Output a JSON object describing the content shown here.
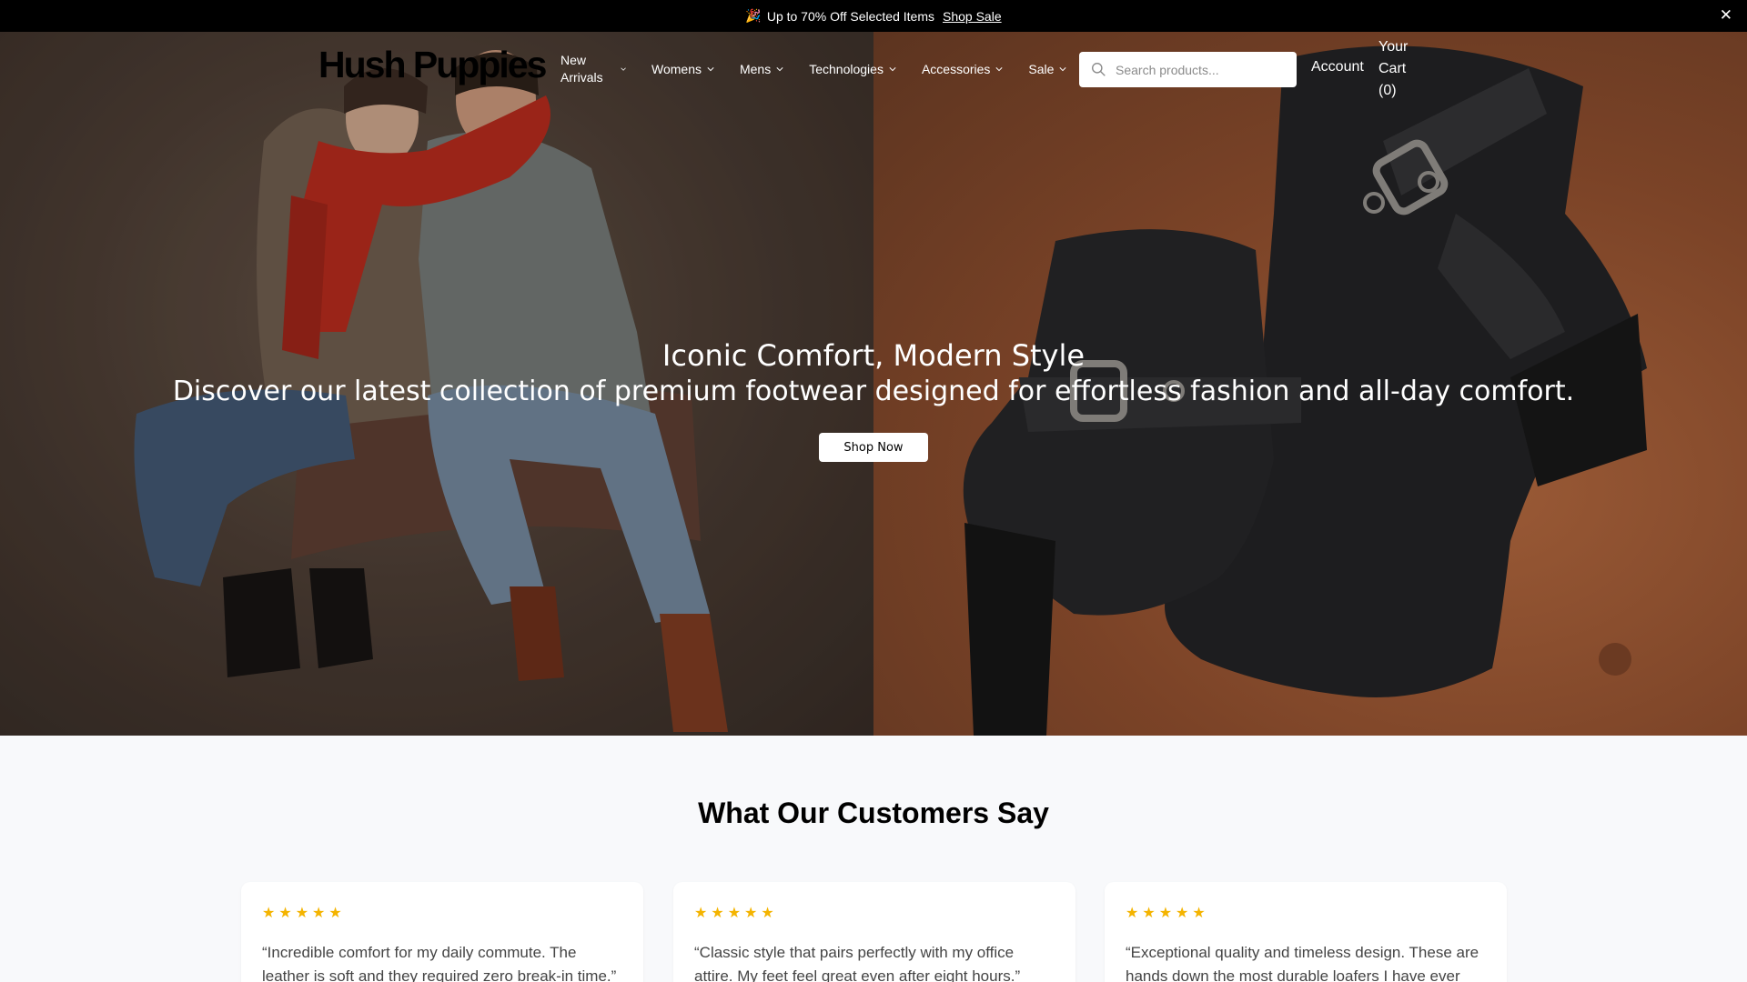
{
  "announcement": {
    "emoji": "🎉",
    "text": "Up to 70% Off Selected Items",
    "link_label": "Shop Sale",
    "close_icon": "close-icon",
    "close_glyph": "✕"
  },
  "header": {
    "logo": "Hush Puppies",
    "nav": [
      {
        "label": "New Arrivals"
      },
      {
        "label": "Womens"
      },
      {
        "label": "Mens"
      },
      {
        "label": "Technologies"
      },
      {
        "label": "Accessories"
      },
      {
        "label": "Sale"
      }
    ],
    "search_placeholder": "Search products...",
    "account_label": "Account",
    "cart_label": "Your Cart (0)"
  },
  "hero": {
    "title": "Iconic Comfort, Modern Style",
    "subtitle": "Discover our latest collection of premium footwear designed for effortless fashion and all-day comfort.",
    "cta_label": "Shop Now"
  },
  "testimonials": {
    "heading": "What Our Customers Say",
    "items": [
      {
        "stars": "★★★★★",
        "rating": 5,
        "quote": "“Incredible comfort for my daily commute. The leather is soft and they required zero break-in time.”"
      },
      {
        "stars": "★★★★★",
        "rating": 5,
        "quote": "“Classic style that pairs perfectly with my office attire. My feet feel great even after eight hours.”"
      },
      {
        "stars": "★★★★★",
        "rating": 5,
        "quote": "“Exceptional quality and timeless design. These are hands down the most durable loafers I have ever"
      }
    ]
  },
  "colors": {
    "announcement_bg": "#000000",
    "star": "#f4b400",
    "section_bg": "#f8f9fb"
  }
}
